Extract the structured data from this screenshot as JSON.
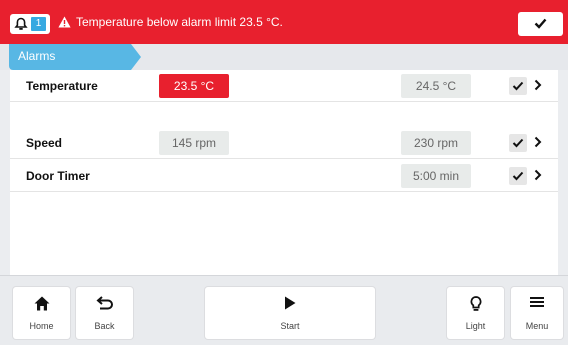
{
  "alarm_banner": {
    "count": "1",
    "message": "Temperature below alarm limit 23.5 °C.",
    "icons": {
      "bell": "bell-icon",
      "warning": "warning-icon",
      "acknowledge": "checkmark-icon"
    },
    "colors": {
      "background": "#e8202e",
      "count_badge": "#36a9e1"
    }
  },
  "breadcrumb": {
    "label": "Alarms",
    "color": "#58b7e4"
  },
  "alarm_rows": [
    {
      "label": "Temperature",
      "low_limit": "23.5 °C",
      "high_limit": "24.5 °C",
      "low_in_alarm": true
    },
    {
      "label": "Speed",
      "low_limit": "145 rpm",
      "high_limit": "230 rpm",
      "low_in_alarm": false
    },
    {
      "label": "Door Timer",
      "low_limit": "",
      "high_limit": "5:00 min",
      "low_in_alarm": false
    }
  ],
  "bottom_nav": {
    "home": {
      "label": "Home",
      "icon": "home-icon"
    },
    "back": {
      "label": "Back",
      "icon": "back-arrow-icon"
    },
    "start": {
      "label": "Start",
      "icon": "play-icon"
    },
    "light": {
      "label": "Light",
      "icon": "lightbulb-icon"
    },
    "menu": {
      "label": "Menu",
      "icon": "hamburger-menu-icon"
    }
  }
}
